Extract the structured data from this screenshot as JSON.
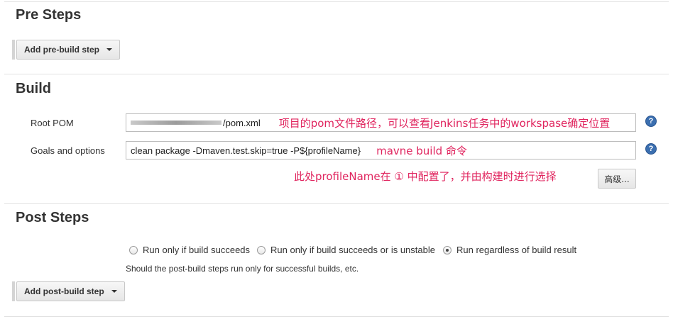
{
  "pre_steps": {
    "title": "Pre Steps",
    "add_button_label": "Add pre-build step"
  },
  "build": {
    "title": "Build",
    "root_pom": {
      "label": "Root POM",
      "value": "/pom.xml",
      "annotation": "项目的pom文件路径，可以查看Jenkins任务中的workspase确定位置"
    },
    "goals": {
      "label": "Goals and options",
      "value": "clean package -Dmaven.test.skip=true -P${profileName}",
      "annotation": "mavne build 命令"
    },
    "profile_annotation": "此处profileName在 ① 中配置了，并由构建时进行选择",
    "advanced_button_label": "高级...",
    "help_icon_text": "?"
  },
  "post_steps": {
    "title": "Post Steps",
    "options": [
      {
        "label": "Run only if build succeeds",
        "checked": false
      },
      {
        "label": "Run only if build succeeds or is unstable",
        "checked": false
      },
      {
        "label": "Run regardless of build result",
        "checked": true
      }
    ],
    "hint": "Should the post-build steps run only for successful builds, etc.",
    "add_button_label": "Add post-build step"
  },
  "colors": {
    "annotation": "#e0245e",
    "help_icon": "#3b6fb0"
  }
}
